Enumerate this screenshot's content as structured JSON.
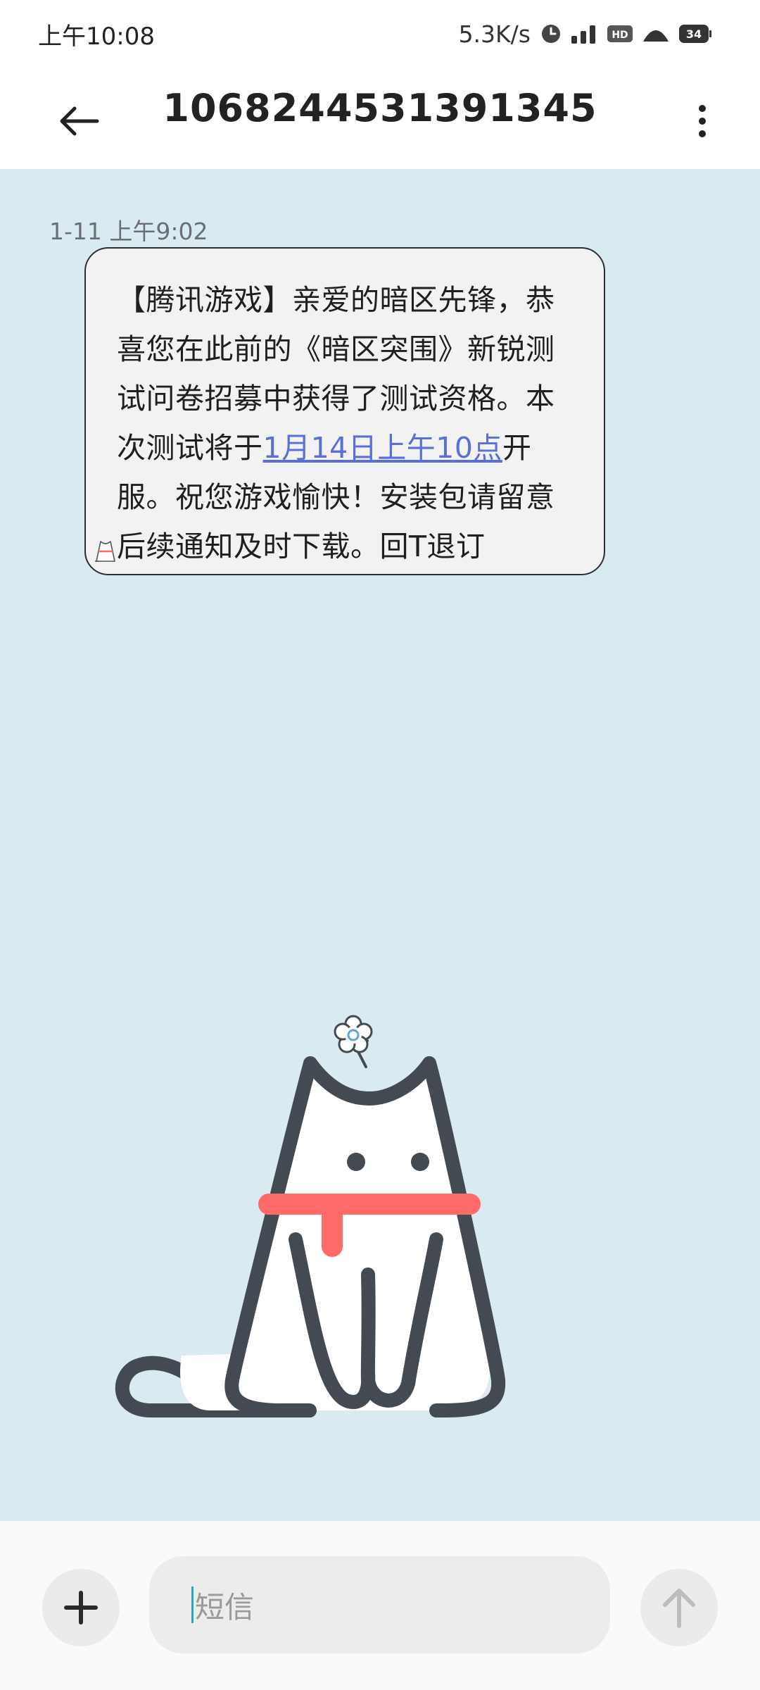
{
  "status_bar": {
    "time": "上午10:08",
    "net_speed": "5.3K/s",
    "hd_label": "HD",
    "battery": "34",
    "icons": [
      "clock-icon",
      "signal-icon",
      "hd-icon",
      "wifi-icon",
      "battery-icon"
    ]
  },
  "header": {
    "title": "1068244531391345",
    "back_icon": "arrow-left-icon",
    "more_icon": "more-vertical-icon"
  },
  "conversation": {
    "message": {
      "timestamp": "1-11 上午9:02",
      "text_before_link": "【腾讯游戏】亲爱的暗区先锋，恭喜您在此前的《暗区突围》新锐测试问卷招募中获得了测试资格。本次测试将于",
      "link_text": "1月14日上午10点",
      "text_after_link": "开服。祝您游戏愉快！安装包请留意后续通知及时下载。回T退订"
    }
  },
  "composer": {
    "placeholder": "短信",
    "add_icon": "plus-icon",
    "send_icon": "arrow-up-icon"
  },
  "colors": {
    "chat_background": "#d9eaf1",
    "bubble_background": "#f2f2f2",
    "link": "#5b6fd6",
    "cat_collar": "#ff6b6b",
    "cat_outline": "#444a52"
  }
}
